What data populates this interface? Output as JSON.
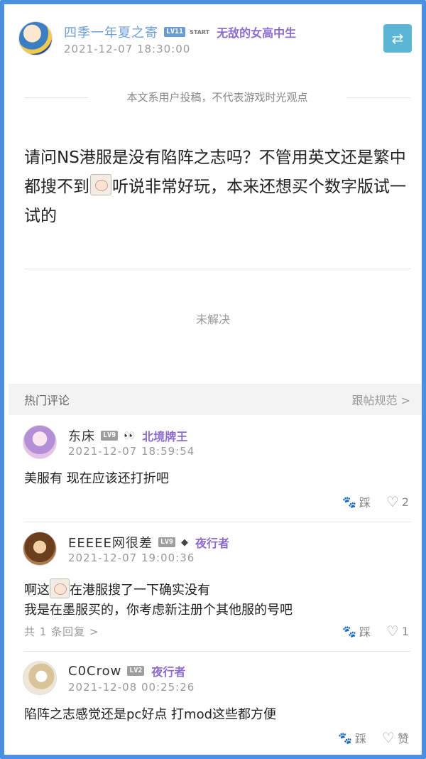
{
  "post": {
    "author": "四季一年夏之寄",
    "level": "LV11",
    "start_tag": "START",
    "title": "无敌的女高中生",
    "date": "2021-12-07 18:30:00",
    "switch_icon": "⇄",
    "disclaimer": "本文系用户投稿，不代表游戏时光观点",
    "body_part1": "请问NS港服是没有陷阵之志吗？不管用英文还是繁中都搜不到",
    "body_part2": "听说非常好玩，本来还想买个数字版试一试的",
    "status": "未解决"
  },
  "hot_comments": {
    "title": "热门评论",
    "rules": "跟帖规范 >"
  },
  "comments": [
    {
      "name": "东床",
      "level": "LV9",
      "medal": "👀",
      "title": "北境牌王",
      "date": "2021-12-07 18:59:54",
      "text": "美服有 现在应该还打折吧",
      "step_label": "踩",
      "likes": "2"
    },
    {
      "name": "EEEEE网很差",
      "level": "LV9",
      "medal": "◆",
      "title": "夜行者",
      "date": "2021-12-07 19:00:36",
      "text_part1": "啊这",
      "text_part2": "在港服搜了一下确实没有",
      "text_line2": "我是在墨服买的，你考虑新注册个其他服的号吧",
      "replies": "共 1 条回复 >",
      "step_label": "踩",
      "likes": "1"
    },
    {
      "name": "C0Crow",
      "level": "LV2",
      "title": "夜行者",
      "date": "2021-12-08 00:25:26",
      "text": "陷阵之志感觉还是pc好点 打mod这些都方便",
      "step_label": "踩",
      "likes": "赞"
    }
  ],
  "colors": {
    "frame": "#4a8fe0",
    "author_name": "#6f9fd8",
    "title_purple": "#8e6ccf",
    "switch_button": "#5bb6d6"
  }
}
